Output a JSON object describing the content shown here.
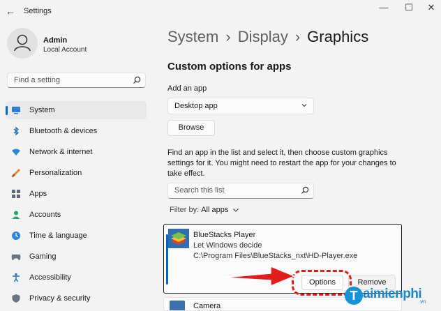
{
  "window": {
    "title": "Settings",
    "controls": {
      "minimize": "—",
      "maximize": "☐",
      "close": "✕"
    }
  },
  "user": {
    "name": "Admin",
    "account_type": "Local Account"
  },
  "sidebar": {
    "search_placeholder": "Find a setting",
    "items": [
      {
        "label": "System",
        "icon": "monitor-icon",
        "active": true
      },
      {
        "label": "Bluetooth & devices",
        "icon": "bluetooth-icon"
      },
      {
        "label": "Network & internet",
        "icon": "wifi-icon"
      },
      {
        "label": "Personalization",
        "icon": "brush-icon"
      },
      {
        "label": "Apps",
        "icon": "apps-icon"
      },
      {
        "label": "Accounts",
        "icon": "person-icon"
      },
      {
        "label": "Time & language",
        "icon": "globe-clock-icon"
      },
      {
        "label": "Gaming",
        "icon": "gamepad-icon"
      },
      {
        "label": "Accessibility",
        "icon": "accessibility-icon"
      },
      {
        "label": "Privacy & security",
        "icon": "shield-icon"
      }
    ]
  },
  "breadcrumb": {
    "items": [
      "System",
      "Display"
    ],
    "current": "Graphics",
    "separator": "›"
  },
  "main": {
    "section_title": "Custom options for apps",
    "add_app_label": "Add an app",
    "add_app_select": "Desktop app",
    "browse_label": "Browse",
    "description": "Find an app in the list and select it, then choose custom graphics settings for it. You might need to restart the app for your changes to take effect.",
    "list_search_placeholder": "Search this list",
    "filter_label": "Filter by:",
    "filter_value": "All apps",
    "apps": [
      {
        "name": "BlueStacks Player",
        "setting": "Let Windows decide",
        "path": "C:\\Program Files\\BlueStacks_nxt\\HD-Player.exe",
        "options_label": "Options",
        "remove_label": "Remove"
      },
      {
        "name": "Camera"
      }
    ]
  },
  "watermark": {
    "logo": "T",
    "text": "aimienphi",
    "suffix": ".vn"
  },
  "colors": {
    "accent": "#0067c0",
    "annotation": "#e01e1e",
    "watermark": "#1a86c9"
  }
}
